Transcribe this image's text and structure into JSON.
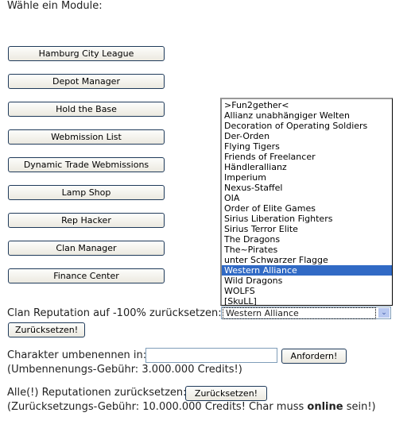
{
  "heading": "Wähle ein Module:",
  "modules": [
    "Hamburg City League",
    "Depot Manager",
    "Hold the Base",
    "Webmission List",
    "Dynamic Trade Webmissions",
    "Lamp Shop",
    "Rep Hacker",
    "Clan Manager",
    "Finance Center"
  ],
  "clan_list": {
    "options": [
      ">Fun2gether<",
      "Allianz unabhängiger Welten",
      "Decoration of Operating Soldiers",
      "Der-Orden",
      "Flying Tigers",
      "Friends of Freelancer",
      "Händlerallianz",
      "Imperium",
      "Nexus-Staffel",
      "OIA",
      "Order of Elite Games",
      "Sirius Liberation Fighters",
      "Sirius Terror Elite",
      "The Dragons",
      "The~Pirates",
      "unter Schwarzer Flagge",
      "Western Alliance",
      "Wild Dragons",
      "WOLFS",
      "[SkuLL]"
    ],
    "selected": "Western Alliance",
    "selected_color": "#316ac5"
  },
  "clan_reset": {
    "label": "Clan Reputation auf -100% zurücksetzen:",
    "button": "Zurücksetzen!",
    "arrow_icon": "chevron-down-icon"
  },
  "rename": {
    "label": "Charakter umbenennen in:",
    "value": "",
    "button": "Anfordern!",
    "fee": "(Umbennenungs-Gebühr: 3.000.000 Credits!)"
  },
  "reset_all": {
    "label": "Alle(!) Reputationen zurücksetzen:",
    "button": "Zurücksetzen!",
    "fee_pre": "(Zurücksetzungs-Gebühr: 10.000.000 Credits! Char muss ",
    "fee_bold": "online",
    "fee_post": " sein!)"
  }
}
